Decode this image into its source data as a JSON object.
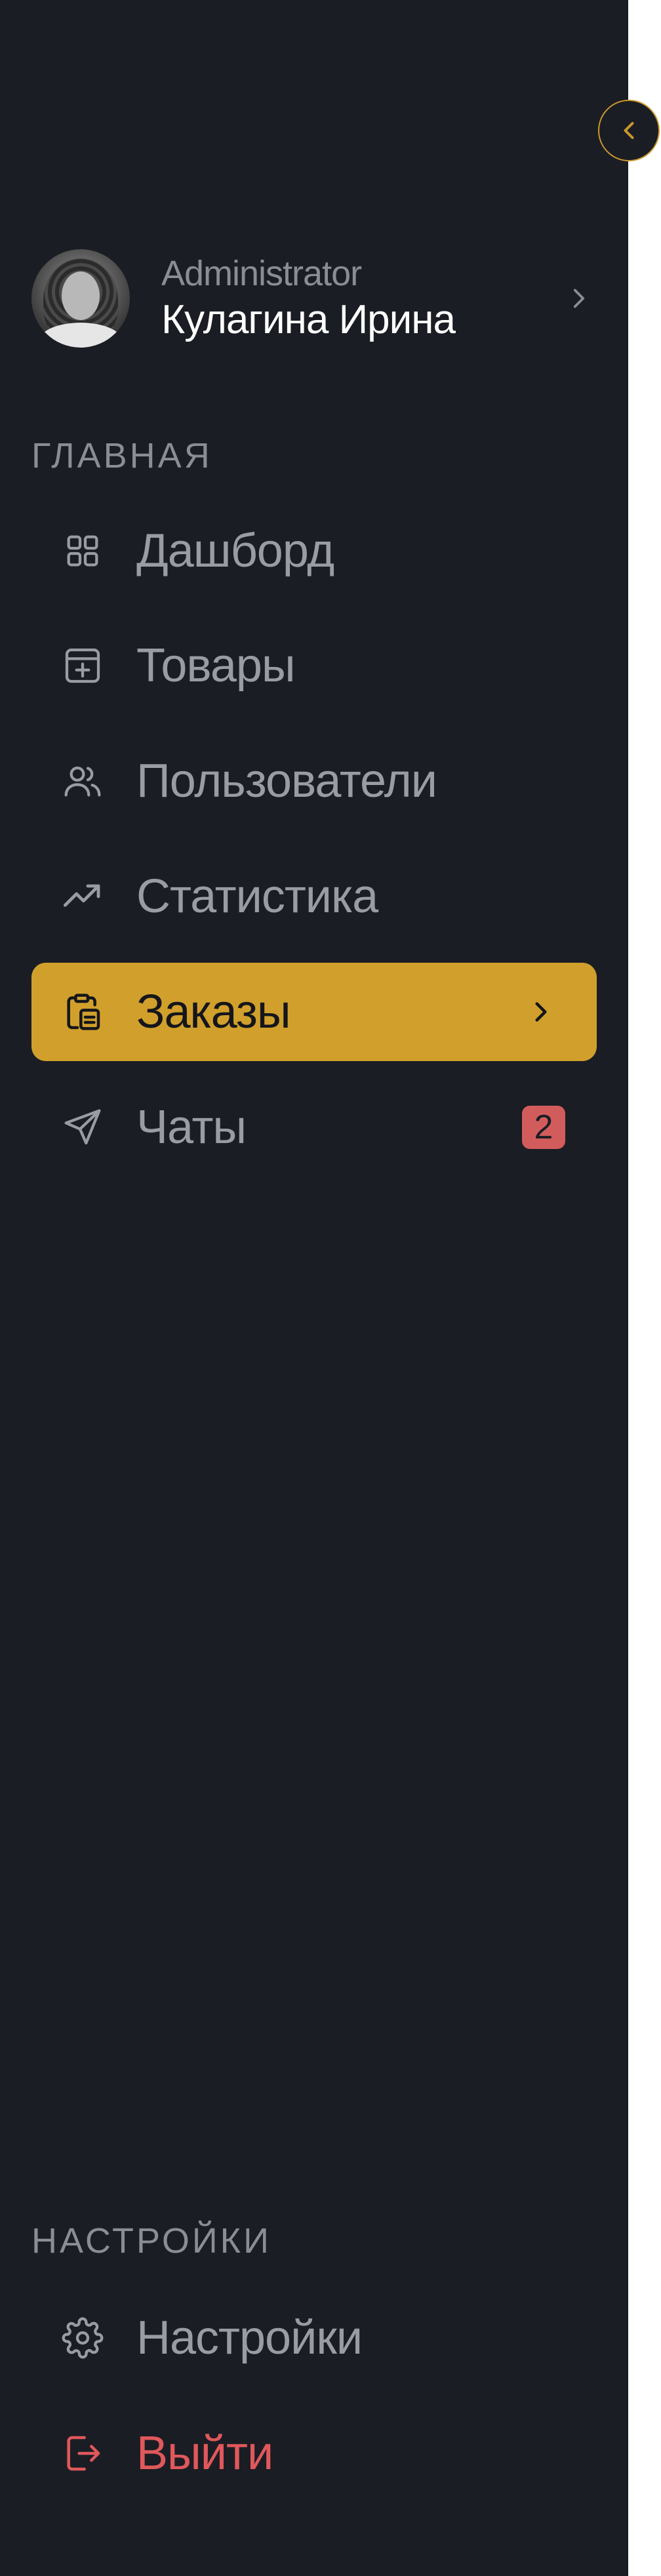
{
  "profile": {
    "role": "Administrator",
    "name": "Кулагина Ирина"
  },
  "sections": {
    "main_title": "ГЛАВНАЯ",
    "settings_title": "НАСТРОЙКИ"
  },
  "nav": {
    "items": [
      {
        "label": "Дашборд",
        "icon": "grid-icon"
      },
      {
        "label": "Товары",
        "icon": "box-plus-icon"
      },
      {
        "label": "Пользователи",
        "icon": "users-icon"
      },
      {
        "label": "Статистика",
        "icon": "trending-up-icon"
      },
      {
        "label": "Заказы",
        "icon": "clipboard-icon",
        "active": true
      },
      {
        "label": "Чаты",
        "icon": "send-icon",
        "badge": "2"
      }
    ]
  },
  "settings": {
    "items": [
      {
        "label": "Настройки",
        "icon": "gear-icon"
      },
      {
        "label": "Выйти",
        "icon": "logout-icon"
      }
    ]
  },
  "colors": {
    "sidebar_bg": "#1b1d24",
    "accent": "#d1a02c",
    "danger": "#e0585b",
    "muted_text": "#9a9ca3"
  }
}
